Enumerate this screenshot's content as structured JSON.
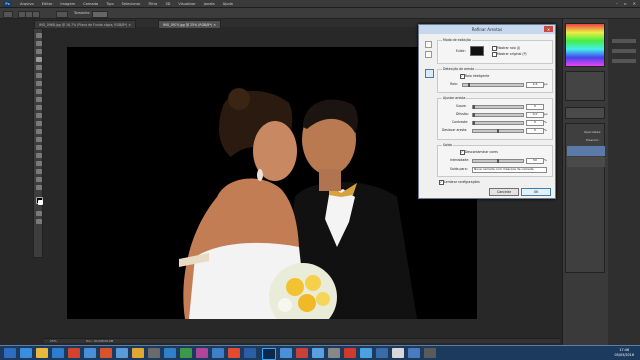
{
  "app": {
    "logo": "Ps"
  },
  "menu": [
    "Arquivo",
    "Editar",
    "Imagem",
    "Camada",
    "Tipo",
    "Selecionar",
    "Filtro",
    "3D",
    "Visualizar",
    "Janela",
    "Ajuda"
  ],
  "window_controls": {
    "minimize": "–",
    "maximize": "▫",
    "close": "✕"
  },
  "workspace_label": "Essenciais",
  "options_bar": {
    "size_label": "Tamanho:"
  },
  "tabs": [
    {
      "label": "IMG_0968.jpg @ 16,7% (Plano de Fundo cópia, RGB/8*) ×"
    },
    {
      "label": "IMG_0974.jpg @ 25% (RGB/8*) ×"
    }
  ],
  "status": {
    "zoom": "25%",
    "doc": "Doc: 40,0M/40,0M"
  },
  "dialog": {
    "title": "Refinar Arestas",
    "close": "✕",
    "view_mode": {
      "title": "Modo de exibição",
      "view_label": "Exibir:",
      "show_radius": "Mostrar raio (J)",
      "show_original": "Mostrar original (P)"
    },
    "edge_detection": {
      "title": "Detecção de aresta",
      "smart_radius": "Raio inteligente",
      "radius_label": "Raio:",
      "radius_value": "2,6",
      "radius_unit": "px"
    },
    "adjust_edge": {
      "title": "Ajustar aresta",
      "rows": [
        {
          "label": "Suave:",
          "value": "0",
          "unit": ""
        },
        {
          "label": "Difusão:",
          "value": "0,0",
          "unit": "px"
        },
        {
          "label": "Contraste:",
          "value": "0",
          "unit": "%"
        },
        {
          "label": "Deslocar aresta:",
          "value": "0",
          "unit": "%"
        }
      ]
    },
    "output": {
      "title": "Saída",
      "decontaminate": "Descontaminar cores",
      "amount_label": "Intensidade:",
      "amount_value": "50",
      "amount_unit": "%",
      "output_to_label": "Saída para:",
      "output_to_value": "Nova camada com máscara de camada"
    },
    "remember": "Lembrar configurações",
    "cancel": "Cancelar",
    "ok": "OK"
  },
  "panels": {
    "opacity_label": "Opacidade:",
    "fill_label": "Preench.:"
  },
  "clock": {
    "time": "17:46",
    "date": "05/05/2016"
  },
  "colors": {
    "taskbar": "#1c3a5e",
    "dialog_title": "#c7d8ee",
    "accent": "#3c7fb1"
  }
}
